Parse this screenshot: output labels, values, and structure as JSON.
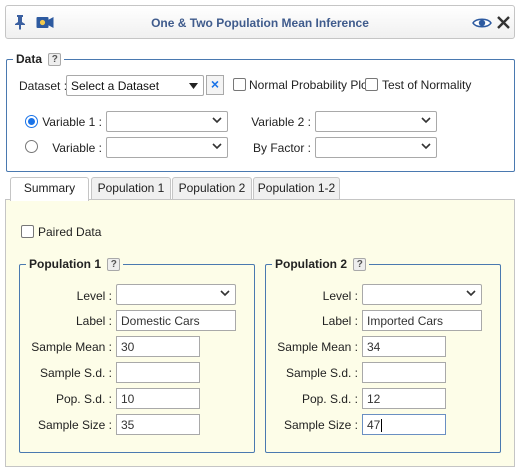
{
  "header": {
    "title": "One & Two Population Mean Inference"
  },
  "data_section": {
    "legend": "Data",
    "help": "?",
    "dataset_label": "Dataset :",
    "dataset_value": "Select a Dataset",
    "clear_icon": "×",
    "normal_plot_label": "Normal Probability Plot",
    "normality_test_label": "Test of Normality",
    "variable1_label": "Variable 1 :",
    "variable2_label": "Variable 2 :",
    "variable_label": "Variable :",
    "by_factor_label": "By Factor :",
    "variable1_value": "",
    "variable2_value": "",
    "variable_value": "",
    "by_factor_value": ""
  },
  "tabs": [
    {
      "label": "Summary",
      "active": true
    },
    {
      "label": "Population 1",
      "active": false
    },
    {
      "label": "Population 2",
      "active": false
    },
    {
      "label": "Population 1-2",
      "active": false
    }
  ],
  "summary": {
    "paired_label": "Paired Data",
    "pop1": {
      "legend": "Population 1",
      "help": "?",
      "level_label": "Level :",
      "level_value": "",
      "label_label": "Label :",
      "label_value": "Domestic Cars",
      "sample_mean_label": "Sample Mean :",
      "sample_mean_value": "30",
      "sample_sd_label": "Sample S.d. :",
      "sample_sd_value": "",
      "pop_sd_label": "Pop. S.d. :",
      "pop_sd_value": "10",
      "sample_size_label": "Sample Size :",
      "sample_size_value": "35"
    },
    "pop2": {
      "legend": "Population 2",
      "help": "?",
      "level_label": "Level :",
      "level_value": "",
      "label_label": "Label :",
      "label_value": "Imported Cars",
      "sample_mean_label": "Sample Mean :",
      "sample_mean_value": "34",
      "sample_sd_label": "Sample S.d. :",
      "sample_sd_value": "",
      "pop_sd_label": "Pop. S.d. :",
      "pop_sd_value": "12",
      "sample_size_label": "Sample Size :",
      "sample_size_value": "47"
    }
  },
  "colors": {
    "accent": "#1a73e8",
    "title": "#3f5b8c",
    "fieldset_border": "#4a79b0",
    "panel_bg": "#fdfde8"
  }
}
